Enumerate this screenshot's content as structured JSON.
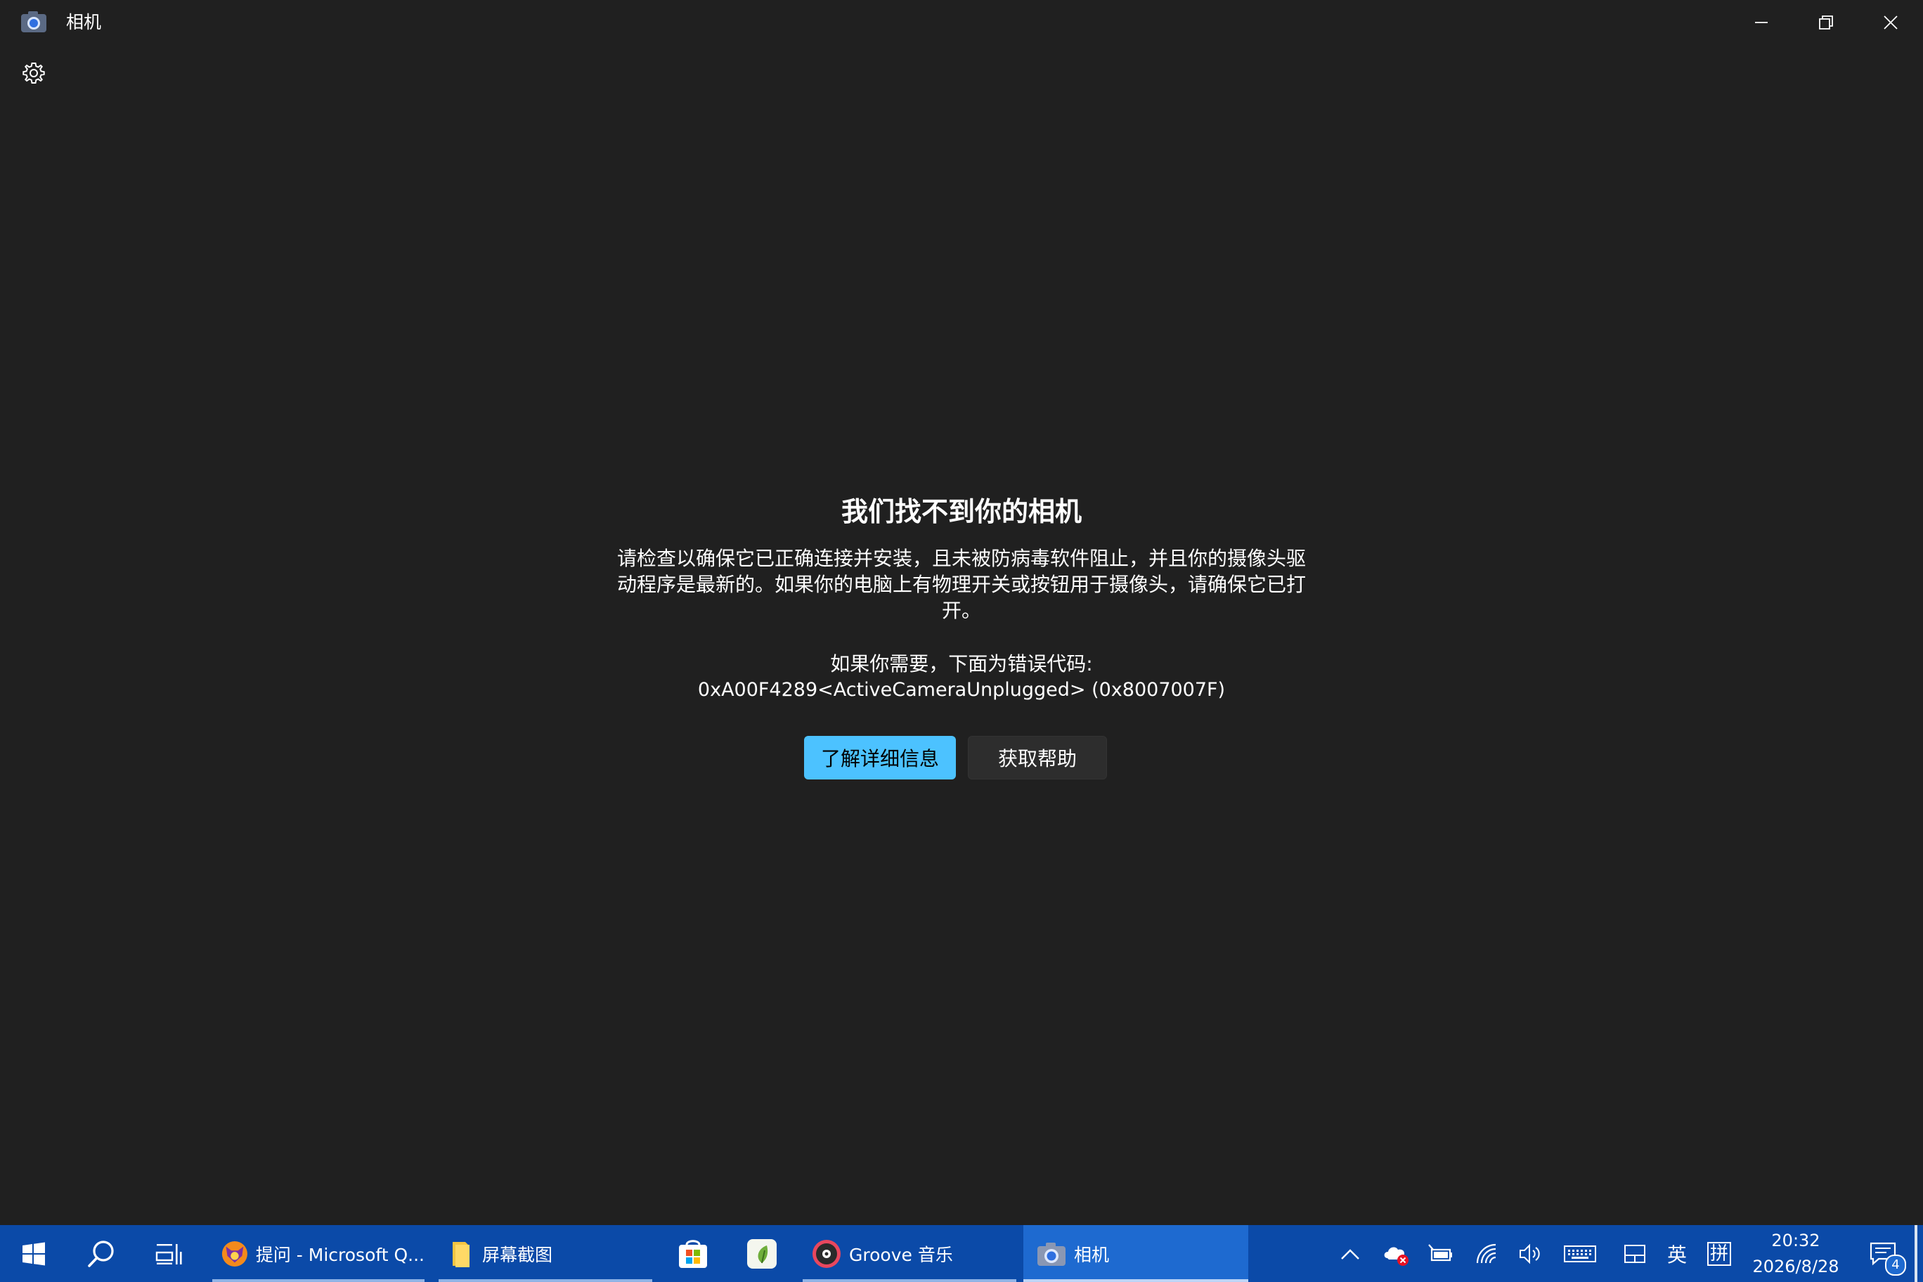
{
  "window": {
    "title": "相机",
    "controls": {
      "minimize": "minimize",
      "restore": "restore",
      "close": "close"
    }
  },
  "settings": {
    "icon": "gear-icon"
  },
  "error": {
    "title": "我们找不到你的相机",
    "body_line1": "请检查以确保它已正确连接并安装，且未被防病毒软件阻止，并且你的摄像头驱",
    "body_line2": "动程序是最新的。如果你的电脑上有物理开关或按钮用于摄像头，请确保它已打",
    "body_line3": "开。",
    "help_text": "如果你需要，下面为错误代码:",
    "code": "0xA00F4289<ActiveCameraUnplugged> (0x8007007F)",
    "learn_more_label": "了解详细信息",
    "get_help_label": "获取帮助",
    "accent_color": "#4cc2ff"
  },
  "taskbar": {
    "color": "#0b4aa8",
    "start_icon": "windows-icon",
    "search_icon": "search-icon",
    "taskview_icon": "task-view-icon",
    "apps": [
      {
        "label": "提问 - Microsoft Q...",
        "icon": "fox-browser-icon"
      },
      {
        "label": "屏幕截图",
        "icon": "folder-icon"
      },
      {
        "label": "",
        "icon": "microsoft-store-icon"
      },
      {
        "label": "",
        "icon": "leaf-app-icon"
      },
      {
        "label": "Groove 音乐",
        "icon": "groove-music-icon"
      },
      {
        "label": "相机",
        "icon": "camera-icon"
      }
    ],
    "tray": {
      "chevron": "chevron-up-icon",
      "onedrive": "onedrive-error-icon",
      "battery": "battery-icon",
      "wifi": "wifi-icon",
      "volume": "volume-icon",
      "keyboard": "keyboard-icon",
      "tablet": "tablet-mode-icon",
      "ime_lang": "英",
      "ime_mode": "拼"
    },
    "time": "20:32",
    "date": "2026/8/28",
    "notifications_count": "4"
  }
}
